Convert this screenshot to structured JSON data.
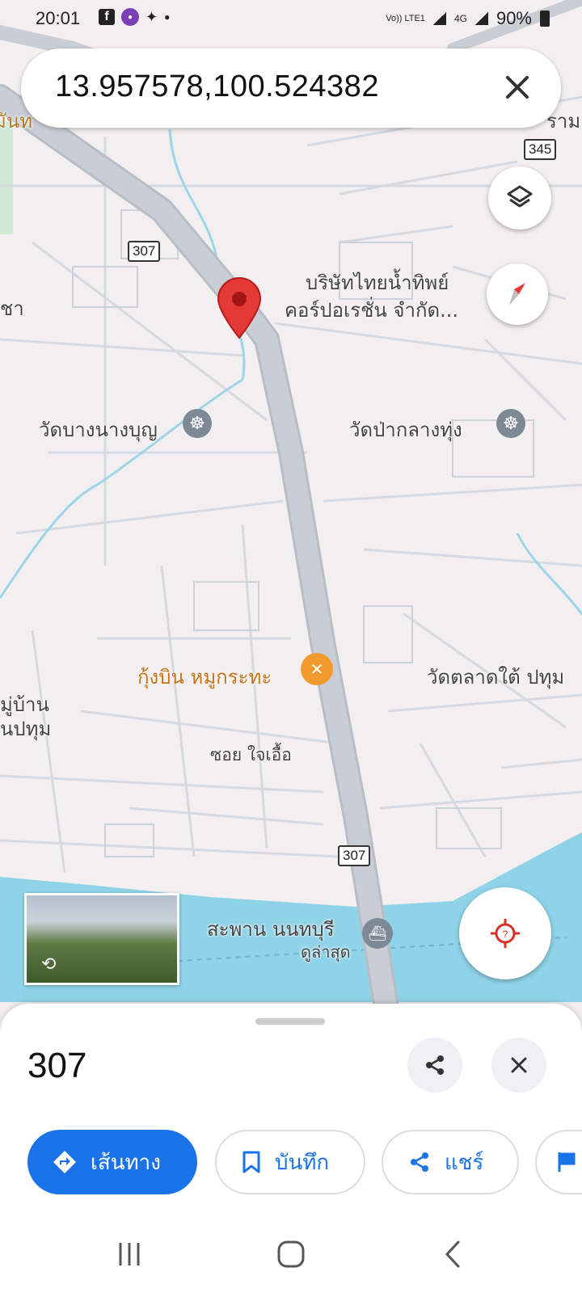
{
  "status_bar": {
    "time": "20:01",
    "network": "Vo)) LTE1",
    "signal_label": "4G",
    "battery": "90%"
  },
  "search": {
    "query": "13.957578,100.524382",
    "clear_icon": "close-icon"
  },
  "map": {
    "partial_labels": {
      "top_left": "มันท",
      "top_right": "ราม",
      "left_mid": "ชา",
      "left_village_1": "มู่บ้าน",
      "left_village_2": "นปทุม"
    },
    "pois": {
      "company_line1": "บริษัทไทยน้ำทิพย์",
      "company_line2": "คอร์ปอเรชั่น จำกัด...",
      "temple1": "วัดบางนางบุญ",
      "temple2": "วัดป่ากลางทุ่ง",
      "restaurant": "กุ้งบิน หมูกระทะ",
      "temple3": "วัดตลาดใต้ ปทุม",
      "soi": "ซอย ใจเอื้อ",
      "pier": "สะพาน นนทบุรี",
      "pier_sub": "ดูล่าสุด"
    },
    "route_shields": {
      "r307_top": "307",
      "r345": "345",
      "r307_bottom": "307"
    },
    "colors": {
      "road": "#c9cdd4",
      "water": "#8fd3e8",
      "pin": "#e53935",
      "restaurant": "#f29a2e",
      "poi_gray": "#7d8a96"
    }
  },
  "place": {
    "title": "307"
  },
  "actions": {
    "directions": "เส้นทาง",
    "save": "บันทึก",
    "share": "แชร์"
  },
  "colors": {
    "accent": "#1a73e8",
    "my_location": "#d93025"
  }
}
